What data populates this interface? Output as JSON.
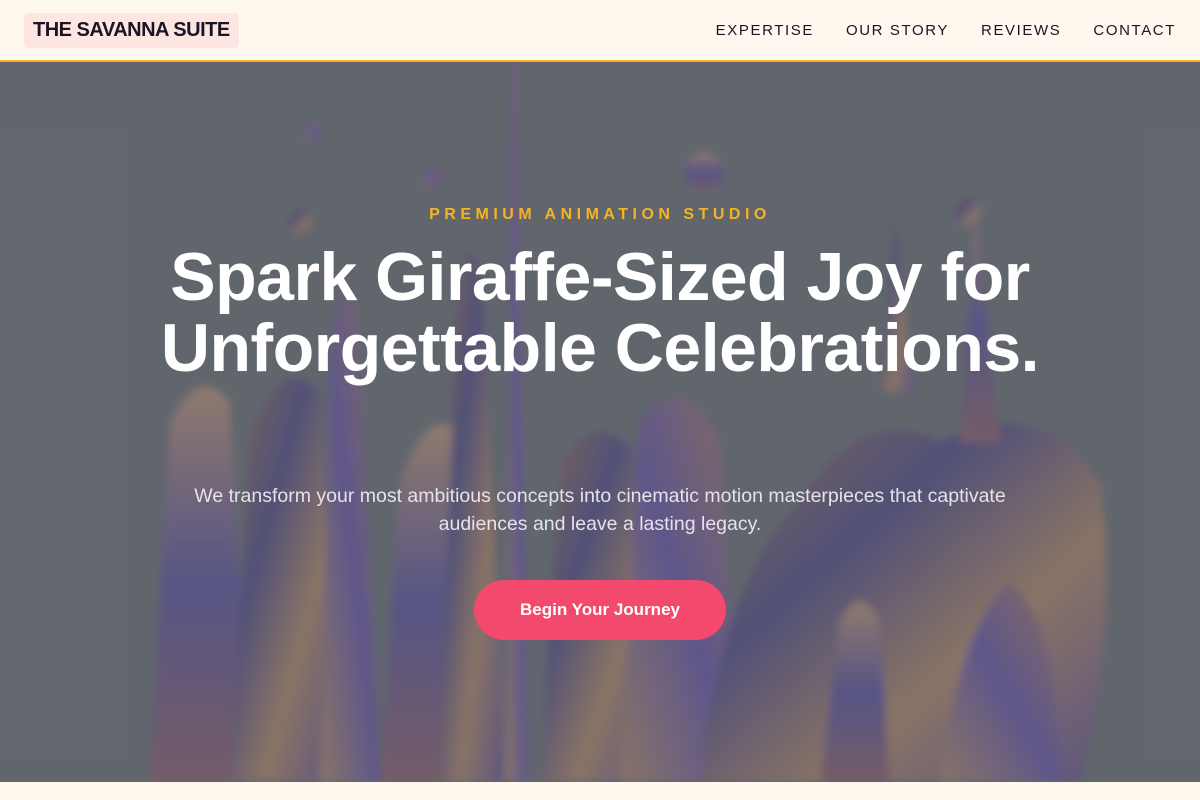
{
  "nav": {
    "brand": "THE SAVANNA SUITE",
    "links": [
      "EXPERTISE",
      "OUR STORY",
      "REVIEWS",
      "CONTACT"
    ]
  },
  "hero": {
    "eyebrow": "PREMIUM ANIMATION STUDIO",
    "headline": "Spark Giraffe-Sized Joy for Unforgettable Celebrations.",
    "subtext": "We transform your most ambitious concepts into cinematic motion masterpieces that captivate audiences and leave a lasting legacy.",
    "cta_label": "Begin Your Journey"
  },
  "colors": {
    "accent_gold": "#f5b324",
    "cta_pink": "#f2496c",
    "background_cream": "#fff8ee",
    "overlay_gray": "#646970"
  }
}
